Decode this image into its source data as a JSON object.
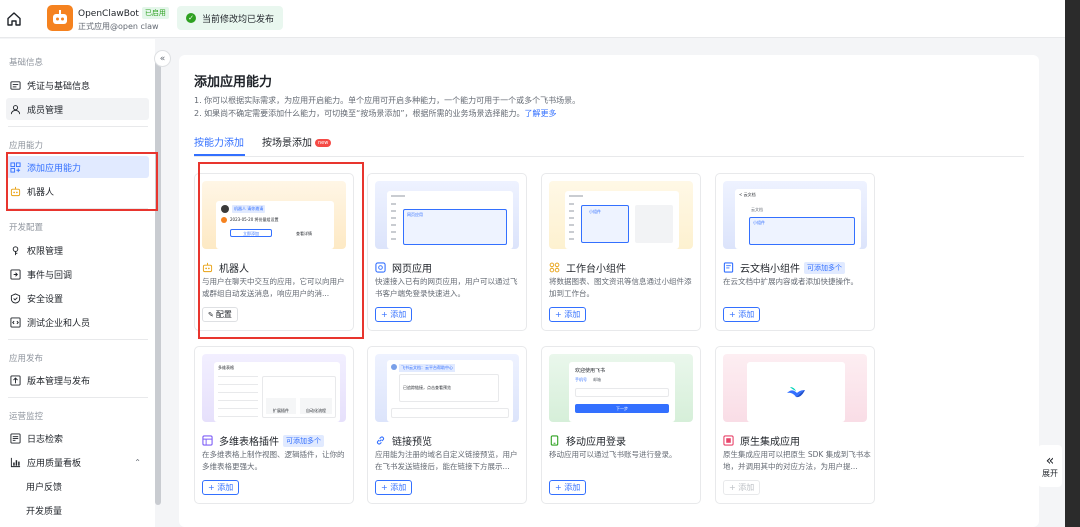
{
  "header": {
    "app_name": "OpenClawBot",
    "app_badge": "已启用",
    "app_subtitle": "正式应用@open claw",
    "status_text": "当前修改均已发布"
  },
  "sidebar": {
    "sections": [
      {
        "title": "基础信息",
        "items": [
          {
            "label": "凭证与基础信息",
            "icon": "credential-icon"
          },
          {
            "label": "成员管理",
            "icon": "user-icon"
          }
        ]
      },
      {
        "title": "应用能力",
        "items": [
          {
            "label": "添加应用能力",
            "icon": "grid-add-icon"
          },
          {
            "label": "机器人",
            "icon": "robot-icon"
          }
        ]
      },
      {
        "title": "开发配置",
        "items": [
          {
            "label": "权限管理",
            "icon": "permission-icon"
          },
          {
            "label": "事件与回调",
            "icon": "event-icon"
          },
          {
            "label": "安全设置",
            "icon": "shield-icon"
          },
          {
            "label": "测试企业和人员",
            "icon": "code-icon"
          }
        ]
      },
      {
        "title": "应用发布",
        "items": [
          {
            "label": "版本管理与发布",
            "icon": "upload-icon"
          }
        ]
      },
      {
        "title": "运营监控",
        "items": [
          {
            "label": "日志检索",
            "icon": "log-icon"
          },
          {
            "label": "应用质量看板",
            "icon": "chart-icon"
          },
          {
            "label": "用户反馈",
            "icon": ""
          },
          {
            "label": "开发质量",
            "icon": ""
          }
        ]
      }
    ]
  },
  "main": {
    "title": "添加应用能力",
    "desc1": "1. 你可以根据实际需求，为应用开启能力。单个应用可开启多种能力，一个能力可用于一个或多个飞书场景。",
    "desc2": "2. 如果尚不确定需要添加什么能力，可切换至“按场景添加”，根据所需的业务场景选择能力。",
    "learn_more": "了解更多",
    "tabs": [
      {
        "label": "按能力添加"
      },
      {
        "label": "按场景添加",
        "badge": "new"
      }
    ],
    "cards": [
      {
        "title": "机器人",
        "icon": "robot-icon",
        "desc": "与用户在聊天中交互的应用，它可以向用户或群组自动发送消息，响应用户的消...",
        "button": "配置",
        "tag": ""
      },
      {
        "title": "网页应用",
        "icon": "web-icon",
        "desc": "快速接入已有的网页应用，用户可以通过飞书客户端免登录快速进入。",
        "button": "+ 添加",
        "tag": ""
      },
      {
        "title": "工作台小组件",
        "icon": "widget-icon",
        "desc": "将数据图表、图文资讯等信息通过小组件添加到工作台。",
        "button": "+ 添加",
        "tag": ""
      },
      {
        "title": "云文档小组件",
        "icon": "doc-icon",
        "desc": "在云文档中扩展内容或者添加快捷操作。",
        "button": "+ 添加",
        "tag": "可添加多个"
      },
      {
        "title": "多维表格插件",
        "icon": "table-icon",
        "desc": "在多维表格上制作视图、逻辑插件，让你的多维表格更强大。",
        "button": "+ 添加",
        "tag": "可添加多个"
      },
      {
        "title": "链接预览",
        "icon": "link-icon",
        "desc": "应用能为注册的域名自定义链接预览，用户在飞书发送链接后，能在链接下方展示...",
        "button": "+ 添加",
        "tag": ""
      },
      {
        "title": "移动应用登录",
        "icon": "mobile-icon",
        "desc": "移动应用可以通过飞书账号进行登录。",
        "button": "+ 添加",
        "tag": ""
      },
      {
        "title": "原生集成应用",
        "icon": "native-icon",
        "desc": "原生集成应用可以把原生 SDK 集成到飞书本地，并调用其中的对应方法，为用户提...",
        "button": "+ 添加",
        "tag": ""
      }
    ],
    "mock_texts": {
      "robot_chat": "机器人 请你邀请",
      "robot_msg": "2023-05-20 将份量组设置",
      "robot_btn": "立即添加",
      "robot_link": "查看详情",
      "web_tag": "网页应用",
      "widget_tag": "小组件",
      "doc_title": "< 云文档",
      "doc_tag": "云文档",
      "doc_tag2": "小组件",
      "table_title": "多维表格",
      "table_btn1": "扩展插件",
      "table_btn2": "自动化流程",
      "link_msg": "飞书云文档：云平台帮助中心",
      "link_box": "已追踪链接，点击查看预览",
      "mobile_title": "欢迎使用飞书",
      "mobile_tab1": "手机号",
      "mobile_tab2": "邮箱",
      "mobile_btn": "下一步"
    }
  },
  "expand_label": "展开"
}
